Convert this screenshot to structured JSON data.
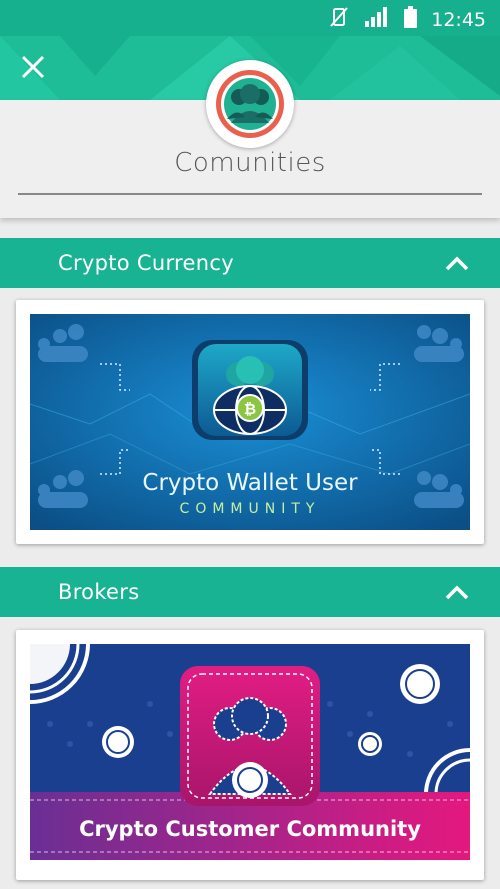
{
  "status_bar": {
    "time": "12:45",
    "icons": [
      "vibrate-off-icon",
      "signal-icon",
      "battery-icon"
    ]
  },
  "header": {
    "close_icon": "close-icon",
    "title": "Comunities",
    "avatar_icon": "community-avatar-icon"
  },
  "sections": [
    {
      "label": "Crypto Currency",
      "chevron": "chevron-up-icon",
      "banner": {
        "title_line1": "Crypto Wallet User",
        "title_line2": "COMMUNITY"
      }
    },
    {
      "label": "Brokers",
      "chevron": "chevron-up-icon",
      "banner": {
        "title": "Crypto Customer Community"
      }
    }
  ],
  "colors": {
    "teal": "#18b392",
    "teal_light": "#1ebd98",
    "blue_banner": "#0f6fb3",
    "navy_banner": "#1a3a8e",
    "magenta": "#e4187f"
  }
}
